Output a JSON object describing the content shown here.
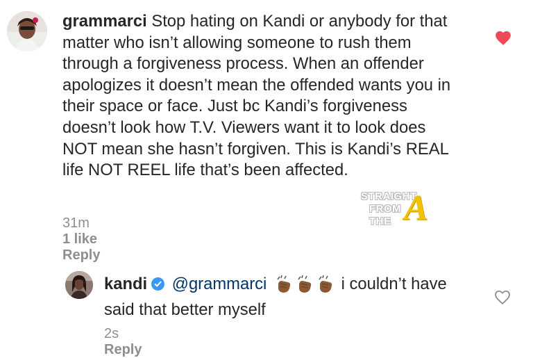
{
  "comments": [
    {
      "username": "grammarci",
      "text": "Stop hating on Kandi or anybody for that matter who isn’t allowing someone to rush them through a forgiveness process. When an offender apologizes it doesn’t mean the offended wants you in their space or face. Just bc Kandi’s forgiveness doesn’t look how T.V. Viewers want it to look does NOT mean she hasn’t forgiven. This is Kandi’s REAL life NOT REEL life that’s been affected.",
      "time": "31m",
      "likes": "1 like",
      "reply_label": "Reply",
      "liked": true,
      "heart_color": "#ed4956",
      "avatar_icon": "profile-photo"
    },
    {
      "username": "kandi",
      "verified": true,
      "mention": "@grammarci",
      "emoji": "clapping-hands-icon x3",
      "text": "i couldn’t have said that better myself",
      "time": "2s",
      "reply_label": "Reply",
      "liked": false,
      "heart_color": "#8e8e8e",
      "avatar_icon": "profile-photo"
    }
  ],
  "watermark": {
    "line1": "STRAIGHT",
    "line2": "FROM",
    "line3": "THE",
    "logo_letter": "A",
    "logo_color": "#f2c200"
  },
  "colors": {
    "text": "#262626",
    "meta": "#8e8e8e",
    "mention": "#003569",
    "verified": "#3897f0"
  }
}
